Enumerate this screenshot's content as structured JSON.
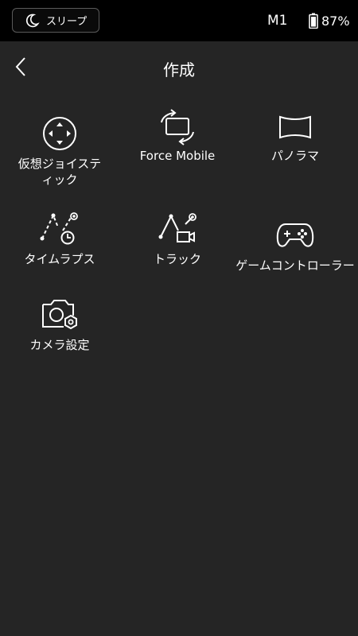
{
  "status_bar": {
    "sleep_label": "スリープ",
    "device": "M1",
    "battery": "87%"
  },
  "header": {
    "title": "作成"
  },
  "menu": {
    "items": [
      {
        "label": "仮想ジョイスティック",
        "icon": "joystick-icon"
      },
      {
        "label": "Force Mobile",
        "icon": "rotate-phone-icon"
      },
      {
        "label": "パノラマ",
        "icon": "panorama-icon"
      },
      {
        "label": "タイムラプス",
        "icon": "timelapse-icon"
      },
      {
        "label": "トラック",
        "icon": "track-icon"
      },
      {
        "label": "ゲームコントローラー",
        "icon": "gamepad-icon"
      },
      {
        "label": "カメラ設定",
        "icon": "camera-settings-icon"
      }
    ]
  },
  "colors": {
    "background": "#252525",
    "status_bar": "#000000",
    "text": "#ffffff"
  }
}
